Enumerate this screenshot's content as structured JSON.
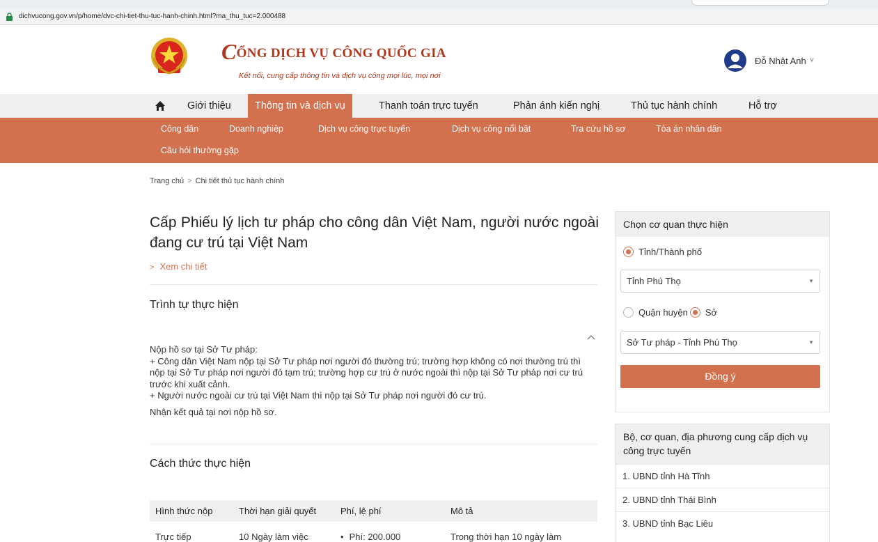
{
  "browser": {
    "url": "dichvucong.gov.vn/p/home/dvc-chi-tiet-thu-tuc-hanh-chinh.html?ma_thu_tuc=2.000488"
  },
  "header": {
    "title_initial": "C",
    "title_rest": "ỔNG DỊCH VỤ CÔNG QUỐC GIA",
    "slogan": "Kết nối, cung cấp thông tin và dịch vụ công mọi lúc, mọi nơi",
    "user_name": "Đỗ Nhật Anh",
    "user_chevron": "˅"
  },
  "nav": {
    "items": [
      {
        "label": "Giới thiệu"
      },
      {
        "label": "Thông tin và dịch vụ"
      },
      {
        "label": "Thanh toán trực tuyến"
      },
      {
        "label": "Phản ánh kiến nghị"
      },
      {
        "label": "Thủ tục hành chính"
      },
      {
        "label": "Hỗ trợ"
      }
    ],
    "active_index": 1
  },
  "subnav": {
    "items": [
      {
        "label": "Công dân"
      },
      {
        "label": "Doanh nghiệp"
      },
      {
        "label": "Dịch vụ công trực tuyến"
      },
      {
        "label": "Dịch vụ công nổi bật"
      },
      {
        "label": "Tra cứu hồ sơ"
      },
      {
        "label": "Tòa án nhân dân"
      },
      {
        "label": "Câu hỏi thường gặp"
      }
    ]
  },
  "breadcrumb": {
    "home": "Trang chủ",
    "separator": ">",
    "current": "Chi tiết thủ tục hành chính"
  },
  "procedure": {
    "title": "Cấp Phiếu lý lịch tư pháp cho công dân Việt Nam, người nước ngoài đang cư trú tại Việt Nam",
    "see_detail": "Xem chi tiết",
    "see_detail_arrow": ">"
  },
  "steps": {
    "title": "Trình tự thực hiện",
    "lines": [
      "Nộp hồ sơ tại Sở Tư pháp:",
      "+ Công dân Việt Nam nộp tại Sở Tư pháp nơi người đó thường trú; trường hợp không có nơi thường trú thì nộp tại Sở Tư pháp nơi người đó tạm trú; trường hợp cư trú ở nước ngoài thì nộp tại Sở Tư pháp nơi cư trú trước khi xuất cảnh.",
      "+ Người nước ngoài cư trú tại Việt Nam thì nộp tại Sở Tư pháp nơi người đó cư trú."
    ],
    "result": "Nhận kết quả tại nơi nộp hồ sơ."
  },
  "methods": {
    "title": "Cách thức thực hiện",
    "columns": [
      "Hình thức nộp",
      "Thời hạn giải quyết",
      "Phí, lệ phí",
      "Mô tả"
    ],
    "rows": [
      {
        "form": "Trực tiếp",
        "duration": "10 Ngày làm việc",
        "fee": "Phí: 200.000",
        "desc": "Trong thời hạn 10 ngày làm"
      }
    ]
  },
  "agency_selector": {
    "title": "Chọn cơ quan thực hiện",
    "level_province": "Tỉnh/Thành phố",
    "province_value": "Tỉnh Phú Thọ",
    "level_district": "Quận huyện",
    "level_department": "Sở",
    "department_value": "Sở Tư pháp - Tỉnh Phú Thọ",
    "caret": "▼",
    "agree_label": "Đồng ý"
  },
  "providers": {
    "title": "Bộ, cơ quan, địa phương cung cấp dịch vụ công trực tuyến",
    "items": [
      "1. UBND tỉnh Hà Tĩnh",
      "2. UBND tỉnh Thái Bình",
      "3. UBND tỉnh Bạc Liêu"
    ]
  },
  "colors": {
    "accent": "#d3704d",
    "brand_red": "#b1371c",
    "nav_bg": "#efefef"
  }
}
